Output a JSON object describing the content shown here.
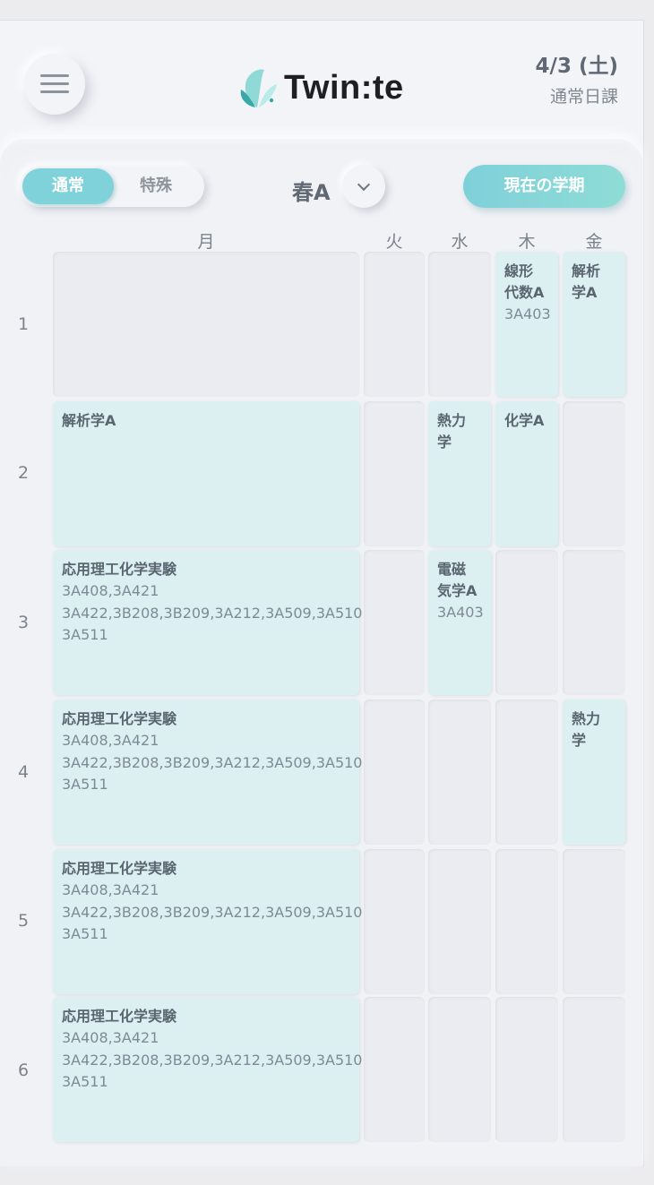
{
  "header": {
    "logo_text": "Twin:te",
    "date": "4/3 (土)",
    "schedule_type": "通常日課"
  },
  "toolbar": {
    "mode_options": [
      "通常",
      "特殊"
    ],
    "selected_mode": "通常",
    "term": "春A",
    "current_term_button": "現在の学期"
  },
  "timetable": {
    "days": [
      "月",
      "火",
      "水",
      "木",
      "金"
    ],
    "periods": [
      "1",
      "2",
      "3",
      "4",
      "5",
      "6"
    ],
    "courses": {
      "mon2": {
        "name": "解析学A",
        "room": ""
      },
      "mon3": {
        "name": "応用理工化学実験",
        "room_lines": [
          "3A408,3A421",
          "3A422,3B208,3B209,3A212,3A509,3A510",
          "3A511"
        ]
      },
      "mon4": {
        "name": "応用理工化学実験",
        "room_lines": [
          "3A408,3A421",
          "3A422,3B208,3B209,3A212,3A509,3A510",
          "3A511"
        ]
      },
      "mon5": {
        "name": "応用理工化学実験",
        "room_lines": [
          "3A408,3A421",
          "3A422,3B208,3B209,3A212,3A509,3A510",
          "3A511"
        ]
      },
      "mon6": {
        "name": "応用理工化学実験",
        "room_lines": [
          "3A408,3A421",
          "3A422,3B208,3B209,3A212,3A509,3A510",
          "3A511"
        ]
      },
      "wed2": {
        "name_lines": [
          "熱力",
          "学"
        ]
      },
      "wed3": {
        "name_lines": [
          "電磁",
          "気学A"
        ],
        "room": "3A403"
      },
      "thu1": {
        "name_lines": [
          "線形",
          "代数A"
        ],
        "room": "3A403"
      },
      "thu2": {
        "name": "化学A"
      },
      "fri1": {
        "name_lines": [
          "解析",
          "学A"
        ]
      },
      "fri4": {
        "name_lines": [
          "熱力",
          "学"
        ]
      }
    }
  },
  "colors": {
    "accent": "#7fd2d9",
    "course_bg": "#dcf0f2",
    "empty_cell": "#ebecf1",
    "background": "#f3f4f8"
  }
}
